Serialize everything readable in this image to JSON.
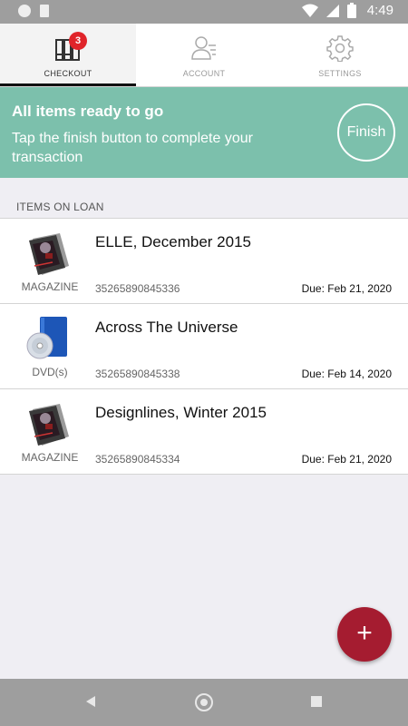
{
  "status_bar": {
    "time": "4:49"
  },
  "tabs": [
    {
      "label": "CHECKOUT",
      "icon": "books-icon",
      "badge": "3",
      "active": true
    },
    {
      "label": "ACCOUNT",
      "icon": "account-icon",
      "active": false
    },
    {
      "label": "SETTINGS",
      "icon": "gear-icon",
      "active": false
    }
  ],
  "banner": {
    "title": "All items ready to go",
    "text": "Tap the finish button to complete your transaction",
    "finish_label": "Finish",
    "color": "#7cc0ac"
  },
  "section_header": "ITEMS ON LOAN",
  "items": [
    {
      "title": "ELLE, December 2015",
      "type": "MAGAZINE",
      "barcode": "35265890845336",
      "due": "Due: Feb 21, 2020",
      "icon": "magazine-icon"
    },
    {
      "title": "Across The Universe",
      "type": "DVD(s)",
      "barcode": "35265890845338",
      "due": "Due: Feb 14, 2020",
      "icon": "dvd-icon"
    },
    {
      "title": "Designlines, Winter 2015",
      "type": "MAGAZINE",
      "barcode": "35265890845334",
      "due": "Due: Feb 21, 2020",
      "icon": "magazine-icon"
    }
  ],
  "fab": {
    "label": "+",
    "icon": "plus-icon",
    "color": "#a51c30"
  },
  "nav": {
    "back_icon": "back-icon",
    "home_icon": "home-icon",
    "recents_icon": "recents-icon"
  }
}
